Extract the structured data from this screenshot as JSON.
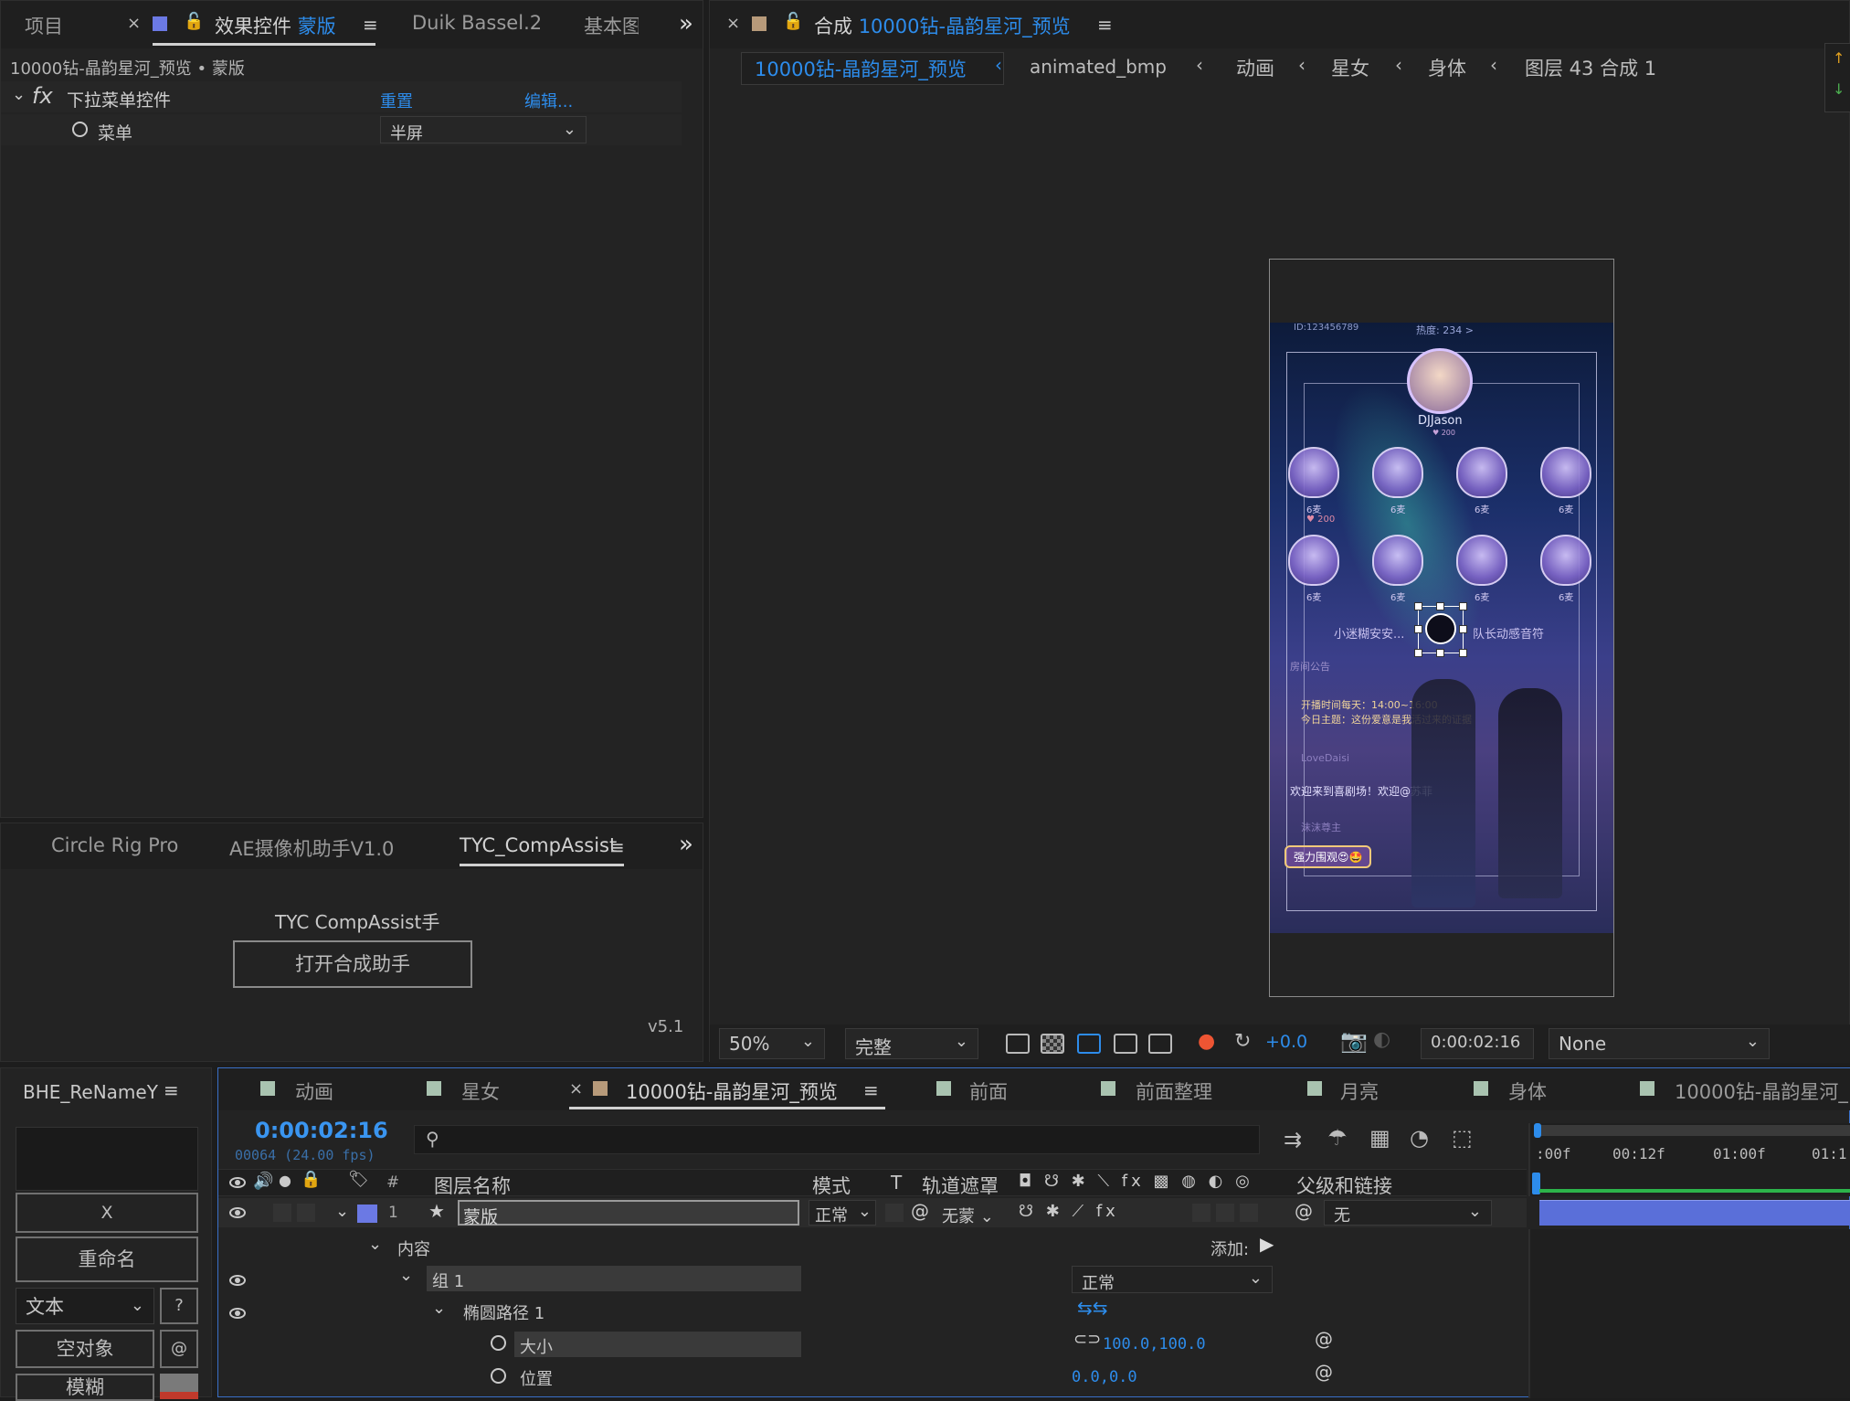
{
  "left_panel": {
    "tabs": [
      "项目",
      "效果控件",
      "Duik Bassel.2",
      "基本图"
    ],
    "active_tab_suffix": "蒙版",
    "overflow": "»",
    "breadcrumb": "10000钻-晶韵星河_预览 • 蒙版",
    "effect": {
      "fx_label": "fx",
      "name": "下拉菜单控件",
      "reset": "重置",
      "edit": "编辑...",
      "param_label": "菜单",
      "param_value": "半屏"
    }
  },
  "plugin_panel": {
    "tabs": [
      "Circle Rig Pro",
      "AE摄像机助手V1.0",
      "TYC_CompAssist"
    ],
    "overflow": "»",
    "title": "TYC CompAssist手",
    "button": "打开合成助手",
    "version": "v5.1"
  },
  "comp_panel": {
    "title_prefix": "合成",
    "comp_name": "10000钻-晶韵星河_预览",
    "breadcrumbs": [
      "10000钻-晶韵星河_预览",
      "animated_bmp",
      "动画",
      "星女",
      "身体",
      "图层 43 合成 1"
    ],
    "preview": {
      "top_text_left": "ID:123456789",
      "top_text_center": "热度: 234 >",
      "host_name": "DJJason",
      "host_sub": "♥ 200",
      "seat_label": "6麦",
      "seat_sub": "♥ 200",
      "left_user": "小迷糊安安...",
      "right_user": "队长动感音符",
      "notice": "房间公告",
      "schedule": "开播时间每天：14:00~16:00",
      "topic": "今日主题：这份爱意是我活过来的证据",
      "chat_user": "LoveDaisi",
      "welcome": "欢迎来到喜剧场！欢迎@苏菲",
      "chat_user2": "沫沫尊主",
      "bubble": "强力围观😍🤩"
    },
    "footer": {
      "zoom": "50%",
      "quality": "完整",
      "exposure": "+0.0",
      "time": "0:00:02:16",
      "view": "None"
    }
  },
  "rename_panel": {
    "title": "BHE_ReNameY",
    "x_button": "X",
    "rename_button": "重命名",
    "type_select": "文本",
    "help": "?",
    "null_button": "空对象",
    "at": "@",
    "blur_button": "模糊"
  },
  "timeline": {
    "tabs": [
      "动画",
      "星女",
      "10000钻-晶韵星河_预览",
      "前面",
      "前面整理",
      "月亮",
      "身体",
      "10000钻-晶韵星河_"
    ],
    "timecode": "0:00:02:16",
    "frames": "00064 (24.00 fps)",
    "search_placeholder": "",
    "columns": {
      "number": "#",
      "layer_name": "图层名称",
      "mode": "模式",
      "t": "T",
      "track_matte": "轨道遮罩",
      "parent": "父级和链接"
    },
    "layer": {
      "index": "1",
      "name": "蒙版",
      "mode": "正常",
      "matte": "无蒙",
      "parent": "无"
    },
    "rows": {
      "contents": "内容",
      "add": "添加:",
      "group": "组 1",
      "group_mode": "正常",
      "ellipse": "椭圆路径 1",
      "size_label": "大小",
      "size_value": "100.0,100.0",
      "pos_label": "位置",
      "pos_value": "0.0,0.0"
    },
    "ruler": [
      ":00f",
      "00:12f",
      "01:00f",
      "01:1"
    ]
  }
}
